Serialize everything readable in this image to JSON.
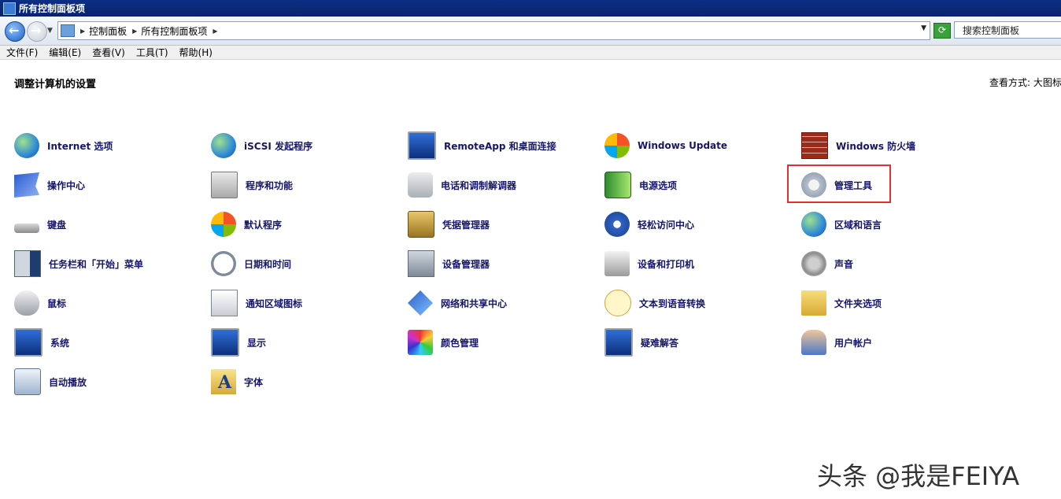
{
  "window": {
    "title": "所有控制面板项"
  },
  "address": {
    "crumbs": [
      "控制面板",
      "所有控制面板项"
    ],
    "search_placeholder": "搜索控制面板"
  },
  "menu": [
    "文件(F)",
    "编辑(E)",
    "查看(V)",
    "工具(T)",
    "帮助(H)"
  ],
  "main": {
    "heading": "调整计算机的设置",
    "view_by": "查看方式:  大图标"
  },
  "items": [
    {
      "label": "Internet 选项",
      "icon": "internet-options-icon"
    },
    {
      "label": "iSCSI 发起程序",
      "icon": "iscsi-icon"
    },
    {
      "label": "RemoteApp 和桌面连接",
      "icon": "remoteapp-icon"
    },
    {
      "label": "Windows Update",
      "icon": "windows-update-icon"
    },
    {
      "label": "Windows 防火墙",
      "icon": "firewall-icon"
    },
    {
      "label": "操作中心",
      "icon": "action-center-icon"
    },
    {
      "label": "程序和功能",
      "icon": "programs-icon"
    },
    {
      "label": "电话和调制解调器",
      "icon": "phone-modem-icon"
    },
    {
      "label": "电源选项",
      "icon": "power-icon"
    },
    {
      "label": "管理工具",
      "icon": "admin-tools-icon"
    },
    {
      "label": "键盘",
      "icon": "keyboard-icon"
    },
    {
      "label": "默认程序",
      "icon": "default-programs-icon"
    },
    {
      "label": "凭据管理器",
      "icon": "credential-manager-icon"
    },
    {
      "label": "轻松访问中心",
      "icon": "ease-of-access-icon"
    },
    {
      "label": "区域和语言",
      "icon": "region-language-icon"
    },
    {
      "label": "任务栏和「开始」菜单",
      "icon": "taskbar-icon"
    },
    {
      "label": "日期和时间",
      "icon": "date-time-icon"
    },
    {
      "label": "设备管理器",
      "icon": "device-manager-icon"
    },
    {
      "label": "设备和打印机",
      "icon": "printer-icon"
    },
    {
      "label": "声音",
      "icon": "sound-icon"
    },
    {
      "label": "鼠标",
      "icon": "mouse-icon"
    },
    {
      "label": "通知区域图标",
      "icon": "notification-icon"
    },
    {
      "label": "网络和共享中心",
      "icon": "network-icon"
    },
    {
      "label": "文本到语音转换",
      "icon": "speech-icon"
    },
    {
      "label": "文件夹选项",
      "icon": "folder-options-icon"
    },
    {
      "label": "系统",
      "icon": "system-icon"
    },
    {
      "label": "显示",
      "icon": "display-icon"
    },
    {
      "label": "颜色管理",
      "icon": "color-management-icon"
    },
    {
      "label": "疑难解答",
      "icon": "troubleshooting-icon"
    },
    {
      "label": "用户帐户",
      "icon": "user-accounts-icon"
    },
    {
      "label": "自动播放",
      "icon": "autoplay-icon"
    },
    {
      "label": "字体",
      "icon": "fonts-icon"
    }
  ],
  "watermark": "头条 @我是FEIYA"
}
